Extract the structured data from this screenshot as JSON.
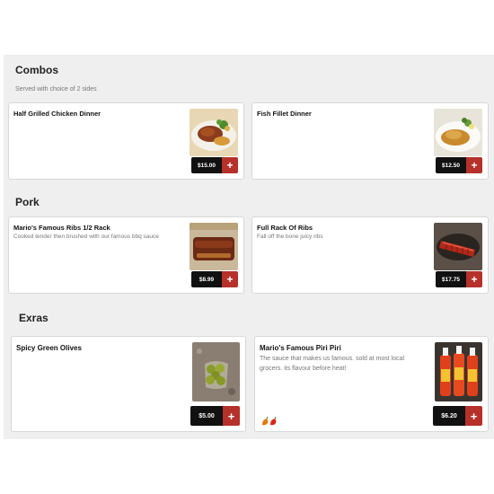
{
  "sections": [
    {
      "title": "Combos",
      "subtitle": "Served with choice of 2 sides",
      "items": [
        {
          "name": "Half Grilled Chicken Dinner",
          "description": "",
          "price": "$15.00",
          "add": "+",
          "photo": "grilled-chicken-photo"
        },
        {
          "name": "Fish Fillet Dinner",
          "description": "",
          "price": "$12.50",
          "add": "+",
          "photo": "fish-fillet-photo"
        }
      ]
    },
    {
      "title": "Pork",
      "subtitle": "",
      "items": [
        {
          "name": "Mario's Famous Ribs 1/2 Rack",
          "description": "Cooked tender then brushed with our famous bbq sauce",
          "price": "$8.99",
          "add": "+",
          "photo": "ribs-half-photo"
        },
        {
          "name": "Full Rack Of Ribs",
          "description": "Fall off the bone juicy ribs",
          "price": "$17.75",
          "add": "+",
          "photo": "ribs-full-photo"
        }
      ]
    },
    {
      "title": "Exras",
      "subtitle": "",
      "items": [
        {
          "name": "Spicy Green Olives",
          "description": "",
          "price": "$5.00",
          "add": "+",
          "photo": "green-olives-photo"
        },
        {
          "name": "Mario's Famous Piri Piri",
          "description": "The sauce that makes us famous. sold at most local grocers. its flavour before heat!",
          "price": "$6.20",
          "add": "+",
          "photo": "piri-piri-bottles-photo",
          "badge": "hot-pepper-icon"
        }
      ]
    }
  ],
  "colors": {
    "accent": "#b5312a",
    "price_bg": "#111111",
    "panel_bg": "#efefef"
  }
}
